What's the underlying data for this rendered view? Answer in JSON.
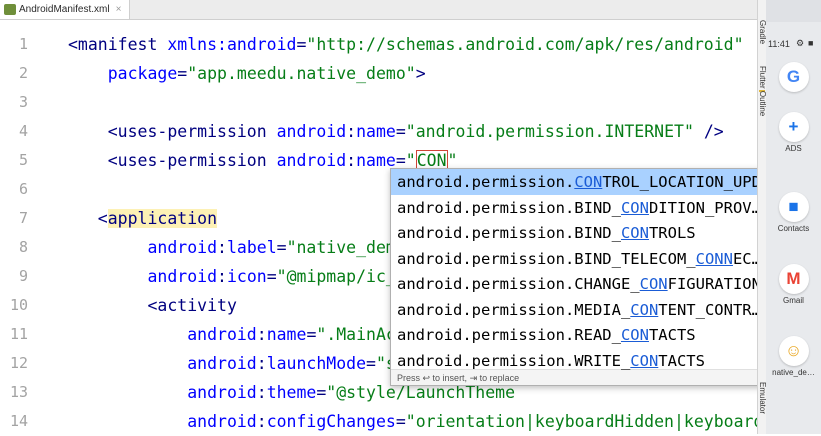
{
  "tab": {
    "filename": "AndroidManifest.xml",
    "close": "×"
  },
  "editor": {
    "line_numbers": [
      "1",
      "2",
      "3",
      "4",
      "5",
      "6",
      "7",
      "8",
      "9",
      "10",
      "11",
      "12",
      "13",
      "14"
    ],
    "lines": [
      {
        "segs": [
          {
            "t": "<manifest ",
            "c": "tag"
          },
          {
            "t": "xmlns:android",
            "c": "attr"
          },
          {
            "t": "=",
            "c": "tag"
          },
          {
            "t": "\"http://schemas.android.com/apk/res/android\"",
            "c": "val"
          }
        ]
      },
      {
        "segs": [
          {
            "t": "    package",
            "c": "attr"
          },
          {
            "t": "=",
            "c": "tag"
          },
          {
            "t": "\"app.meedu.native_demo\"",
            "c": "val"
          },
          {
            "t": ">",
            "c": "tag"
          }
        ]
      },
      {
        "segs": []
      },
      {
        "segs": [
          {
            "t": "    <uses-permission ",
            "c": "tag"
          },
          {
            "t": "android",
            "c": "attr"
          },
          {
            "t": ":",
            "c": "tag"
          },
          {
            "t": "name",
            "c": "attr"
          },
          {
            "t": "=",
            "c": "tag"
          },
          {
            "t": "\"android.permission.INTERNET\"",
            "c": "val"
          },
          {
            "t": " />",
            "c": "tag"
          }
        ]
      },
      {
        "segs": [
          {
            "t": "    <uses-permission ",
            "c": "tag"
          },
          {
            "t": "android",
            "c": "attr"
          },
          {
            "t": ":",
            "c": "tag"
          },
          {
            "t": "name",
            "c": "attr"
          },
          {
            "t": "=",
            "c": "tag"
          },
          {
            "t": "\"",
            "c": "val"
          },
          {
            "t": "CON",
            "c": "val cursorbox"
          },
          {
            "t": "\"",
            "c": "val"
          }
        ]
      },
      {
        "segs": []
      },
      {
        "segs": [
          {
            "t": "   <",
            "c": "tag"
          },
          {
            "t": "application",
            "c": "tag hl-tag"
          }
        ]
      },
      {
        "segs": [
          {
            "t": "        android",
            "c": "attr"
          },
          {
            "t": ":",
            "c": "tag"
          },
          {
            "t": "label",
            "c": "attr"
          },
          {
            "t": "=",
            "c": "tag"
          },
          {
            "t": "\"native_demo\"",
            "c": "val"
          }
        ]
      },
      {
        "segs": [
          {
            "t": "        android",
            "c": "attr"
          },
          {
            "t": ":",
            "c": "tag"
          },
          {
            "t": "icon",
            "c": "attr"
          },
          {
            "t": "=",
            "c": "tag"
          },
          {
            "t": "\"@mipmap/ic_la",
            "c": "val"
          }
        ]
      },
      {
        "segs": [
          {
            "t": "        <activity",
            "c": "tag"
          }
        ]
      },
      {
        "segs": [
          {
            "t": "            android",
            "c": "attr"
          },
          {
            "t": ":",
            "c": "tag"
          },
          {
            "t": "name",
            "c": "attr"
          },
          {
            "t": "=",
            "c": "tag"
          },
          {
            "t": "\".MainActi",
            "c": "val"
          }
        ]
      },
      {
        "segs": [
          {
            "t": "            android",
            "c": "attr"
          },
          {
            "t": ":",
            "c": "tag"
          },
          {
            "t": "launchMode",
            "c": "attr"
          },
          {
            "t": "=",
            "c": "tag"
          },
          {
            "t": "\"sir",
            "c": "val"
          }
        ]
      },
      {
        "segs": [
          {
            "t": "            android",
            "c": "attr"
          },
          {
            "t": ":",
            "c": "tag"
          },
          {
            "t": "theme",
            "c": "attr"
          },
          {
            "t": "=",
            "c": "tag"
          },
          {
            "t": "\"@style/LaunchTheme",
            "c": "val"
          }
        ]
      },
      {
        "segs": [
          {
            "t": "            android",
            "c": "attr"
          },
          {
            "t": ":",
            "c": "tag"
          },
          {
            "t": "configChanges",
            "c": "attr"
          },
          {
            "t": "=",
            "c": "tag"
          },
          {
            "t": "\"orientation|keyboardHidden|keyboard|sc",
            "c": "val"
          }
        ]
      }
    ]
  },
  "completion": {
    "items": [
      {
        "pre": "android.permission.",
        "match": "CON",
        "post": "TROL_LOCATION_UPDATES",
        "selected": true
      },
      {
        "pre": "android.permission.BIND_",
        "match": "CON",
        "post": "DITION_PROV…",
        "selected": false
      },
      {
        "pre": "android.permission.BIND_",
        "match": "CON",
        "post": "TROLS",
        "selected": false
      },
      {
        "pre": "android.permission.BIND_TELECOM_",
        "match": "CONN",
        "post": "EC…",
        "selected": false
      },
      {
        "pre": "android.permission.CHANGE_",
        "match": "CON",
        "post": "FIGURATION",
        "selected": false
      },
      {
        "pre": "android.permission.MEDIA_",
        "match": "CON",
        "post": "TENT_CONTR…",
        "selected": false
      },
      {
        "pre": "android.permission.READ_",
        "match": "CON",
        "post": "TACTS",
        "selected": false
      },
      {
        "pre": "android.permission.WRITE_",
        "match": "CON",
        "post": "TACTS",
        "selected": false
      }
    ],
    "footer": "Press ↩ to insert, ⇥ to replace",
    "more": "⋮"
  },
  "side_tabs": {
    "gradle": "Gradle",
    "flutter_outline": "Flutter Outline",
    "emulator": "Emulator"
  },
  "phone": {
    "time": "11:41",
    "apps": [
      {
        "label": "",
        "glyph": "G",
        "color": "#4285f4"
      },
      {
        "label": "ADS",
        "glyph": "+",
        "color": "#1a73e8"
      },
      {
        "label": "Contacts",
        "glyph": "■",
        "color": "#1a73e8"
      },
      {
        "label": "Gmail",
        "glyph": "M",
        "color": "#ea4335"
      },
      {
        "label": "native_de…",
        "glyph": "☺",
        "color": "#e8a317"
      }
    ]
  }
}
